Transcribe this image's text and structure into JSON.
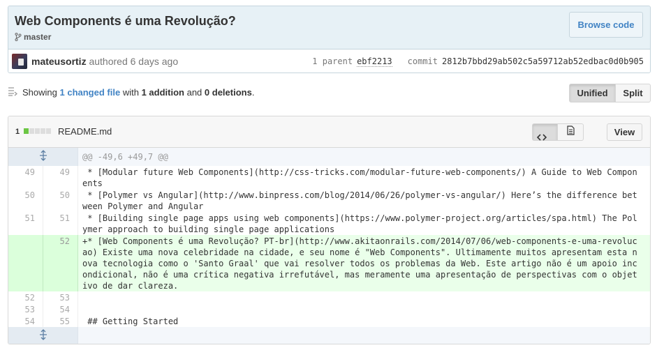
{
  "commit": {
    "title": "Web Components é uma Revolução?",
    "branch": "master",
    "browse_label": "Browse code",
    "author": "mateusortiz",
    "authored_text": "authored 6 days ago",
    "parent_count": "1 parent",
    "parent_sha": "ebf2213",
    "commit_label": "commit",
    "commit_sha": "2812b7bbd29ab502c5a59712ab52edbac0d0b905"
  },
  "toc": {
    "showing": "Showing",
    "changed_files": "1 changed file",
    "with": "with",
    "additions": "1 addition",
    "and": "and",
    "deletions": "0 deletions",
    "period": ".",
    "unified_label": "Unified",
    "split_label": "Split"
  },
  "file": {
    "diffstat_count": "1",
    "diffstat_blocks": [
      "add",
      "none",
      "none",
      "none",
      "none"
    ],
    "name": "README.md",
    "view_label": "View",
    "hunk_header": "@@ -49,6 +49,7 @@",
    "lines": [
      {
        "type": "ctx",
        "old": "49",
        "new": "49",
        "text": " * [Modular future Web Components](http://css-tricks.com/modular-future-web-components/) A Guide to Web Components"
      },
      {
        "type": "ctx",
        "old": "50",
        "new": "50",
        "text": " * [Polymer vs Angular](http://www.binpress.com/blog/2014/06/26/polymer-vs-angular/) Here’s the difference between Polymer and Angular"
      },
      {
        "type": "ctx",
        "old": "51",
        "new": "51",
        "text": " * [Building single page apps using web components](https://www.polymer-project.org/articles/spa.html) The Polymer approach to building single page applications"
      },
      {
        "type": "add",
        "old": "",
        "new": "52",
        "text": "+* [Web Components é uma Revolução? PT-br](http://www.akitaonrails.com/2014/07/06/web-components-e-uma-revolucao) Existe uma nova celebridade na cidade, e seu nome é \"Web Components\". Ultimamente muitos apresentam esta nova tecnologia como o 'Santo Graal' que vai resolver todos os problemas da Web. Este artigo não é um apoio incondicional, não é uma crítica negativa irrefutável, mas meramente uma apresentação de perspectivas com o objetivo de dar clareza."
      },
      {
        "type": "ctx",
        "old": "52",
        "new": "53",
        "text": " "
      },
      {
        "type": "ctx",
        "old": "53",
        "new": "54",
        "text": " "
      },
      {
        "type": "ctx",
        "old": "54",
        "new": "55",
        "text": " ## Getting Started"
      }
    ]
  }
}
